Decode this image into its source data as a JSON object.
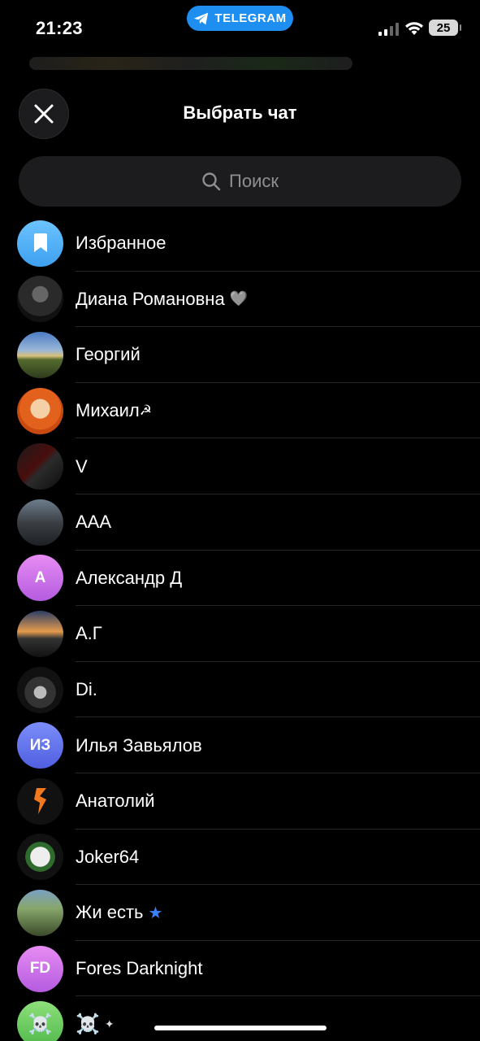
{
  "status_bar": {
    "time": "21:23",
    "app_pill": "TELEGRAM",
    "battery": "25"
  },
  "header": {
    "title": "Выбрать чат"
  },
  "search": {
    "placeholder": "Поиск"
  },
  "colors": {
    "accent": "#1f8ef1",
    "background": "#000000",
    "surface": "#1c1c1e",
    "placeholder": "#8e8e93"
  },
  "chats": [
    {
      "name": "Избранное",
      "avatar_icon": "bookmark-icon",
      "initials": ""
    },
    {
      "name": "Диана Романовна",
      "badge": "🩶",
      "initials": ""
    },
    {
      "name": "Георгий",
      "initials": ""
    },
    {
      "name": "Михаил",
      "badge": "☭",
      "initials": ""
    },
    {
      "name": "V",
      "initials": ""
    },
    {
      "name": "AAA",
      "initials": ""
    },
    {
      "name": "Александр Д",
      "initials": "А"
    },
    {
      "name": "А.Г",
      "initials": ""
    },
    {
      "name": "Di.",
      "initials": ""
    },
    {
      "name": "Илья Завьялов",
      "initials": "ИЗ"
    },
    {
      "name": "Анатолий",
      "initials": ""
    },
    {
      "name": "Joker64",
      "initials": ""
    },
    {
      "name": "Жи есть",
      "badge": "★",
      "initials": ""
    },
    {
      "name": "Fores Darknight",
      "initials": "FD"
    },
    {
      "name": "☠️",
      "badge": "✦",
      "initials": "☠️"
    }
  ]
}
